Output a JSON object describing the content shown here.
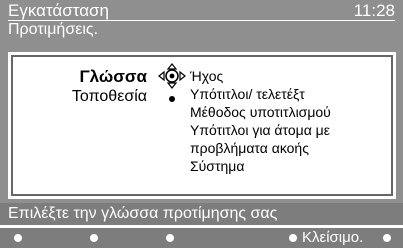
{
  "header": {
    "title": "Εγκατάσταση",
    "clock": "11:28",
    "subtitle": "Προτιμήσεις."
  },
  "menu": {
    "left_items": [
      {
        "label": "Γλώσσα",
        "selected": true
      },
      {
        "label": "Τοποθεσία",
        "selected": false
      }
    ],
    "options": [
      "Ήχος",
      "Υπότιτλοι/ τελετέξτ",
      "Μέθοδος υποτιτλισμού",
      "Υπότιτλοι για άτομα με",
      "προβλήματα ακοής",
      "Σύστημα"
    ]
  },
  "status": {
    "hint": "Επιλέξτε την γλώσσα προτίμησης σας"
  },
  "bottom_bar": {
    "close_label": "Κλείσιμο."
  },
  "icons": {
    "navigation": "dpad-navigation-icon",
    "bullet": "radio-dot-icon"
  },
  "colors": {
    "screen_bg": "#8f8f8f",
    "panel_bg": "#ffffff",
    "text_light": "#ffffff",
    "text_dark": "#000000"
  }
}
